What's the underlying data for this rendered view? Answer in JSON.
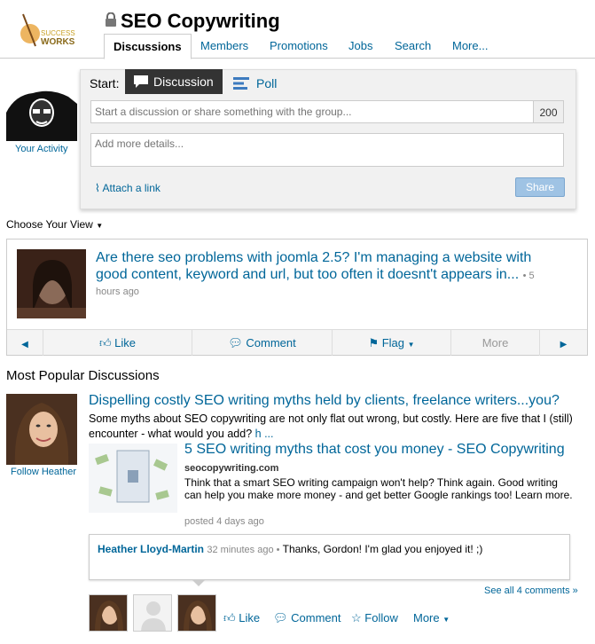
{
  "header": {
    "logo_text": "SUCCESS WORKS",
    "group_title": "SEO Copywriting",
    "tabs": [
      "Discussions",
      "Members",
      "Promotions",
      "Jobs",
      "Search",
      "More..."
    ]
  },
  "sidebar": {
    "your_activity": "Your Activity"
  },
  "composer": {
    "start_label": "Start:",
    "discussion_tab": "Discussion",
    "poll_tab": "Poll",
    "title_placeholder": "Start a discussion or share something with the group...",
    "char_counter": "200",
    "details_placeholder": "Add more details...",
    "attach_label": "Attach a link",
    "share_label": "Share"
  },
  "choose_view": "Choose Your View",
  "featured": {
    "title": "Are there seo problems with joomla 2.5? I'm managing a website with good content, keyword and url, but too often it doesnt't appears in...",
    "time_inline": "• 5",
    "time_rest": "hours ago",
    "actions": {
      "like": "Like",
      "comment": "Comment",
      "flag": "Flag",
      "more": "More"
    }
  },
  "popular": {
    "heading": "Most Popular Discussions",
    "follow_label": "Follow Heather",
    "title": "Dispelling costly SEO writing myths held by clients, freelance writers...you?",
    "body": "Some myths about SEO copywriting are not only flat out wrong, but costly. Here are five that I (still) encounter - what would you add?",
    "body_more": "h ...",
    "link": {
      "title": "5 SEO writing myths that cost you money - SEO Copywriting",
      "domain": "seocopywriting.com",
      "description": "Think that a smart SEO writing campaign won't help? Think again. Good writing can help you make more money - and get better Google rankings too! Learn more.",
      "posted": "posted 4 days ago"
    },
    "comment": {
      "author": "Heather Lloyd-Martin",
      "time": "32 minutes ago •",
      "text": "Thanks, Gordon! I'm glad you enjoyed it! ;)"
    },
    "see_all": "See all 4 comments »",
    "actions": {
      "like": "Like",
      "comment": "Comment",
      "follow": "Follow",
      "more": "More"
    }
  },
  "colors": {
    "link": "#006699",
    "dark_tab": "#333333",
    "share_button": "#9fc3e4"
  }
}
